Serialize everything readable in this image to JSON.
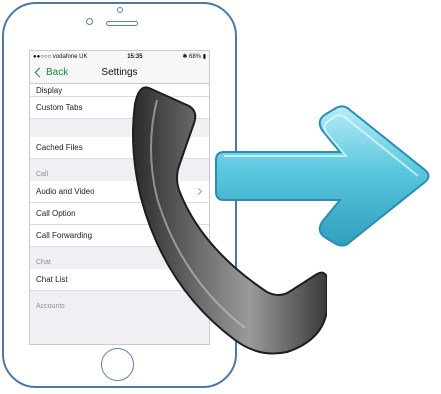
{
  "status_bar": {
    "carrier": "●●○○○ vodafone UK",
    "time": "15:35",
    "battery": "68%"
  },
  "nav": {
    "back_label": "Back",
    "title": "Settings"
  },
  "rows": {
    "display": "Display",
    "custom_tabs": "Custom Tabs",
    "cached_files": "Cached Files",
    "call_section": "Call",
    "audio_video": "Audio and Video",
    "call_option": "Call Option",
    "call_forwarding": "Call Forwarding",
    "chat_section": "Chat",
    "chat_list": "Chat List",
    "accounts_section": "Accounts"
  },
  "colors": {
    "phone_outline": "#4a78a8",
    "back_tint": "#1a8a3a",
    "arrow": "#5cc8e0",
    "handset": "#555555"
  },
  "icons": {
    "arrow": "arrow-right-icon",
    "handset": "phone-handset-icon"
  }
}
